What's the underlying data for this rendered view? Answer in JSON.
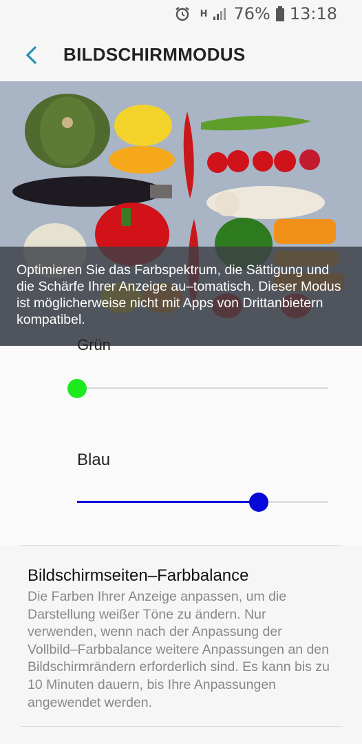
{
  "status_bar": {
    "alarm_icon": "alarm-icon",
    "network": "H",
    "signal_icon": "signal-icon",
    "battery_pct": "76%",
    "battery_icon": "battery-icon",
    "time": "13:18"
  },
  "header": {
    "back_icon": "back-arrow-icon",
    "title": "BILDSCHIRMMODUS"
  },
  "hero": {
    "description": "Optimieren Sie das Farbspektrum, die Sättigung und die Schärfe Ihrer Anzeige au–tomatisch. Dieser Modus ist möglicherweise nicht mit Apps von Drittanbietern kompatibel."
  },
  "sliders": {
    "green": {
      "label": "Grün",
      "value": 0.0,
      "color": "#1ee81e"
    },
    "blue": {
      "label": "Blau",
      "value": 0.725,
      "color": "#0808d8"
    }
  },
  "colors": {
    "accent": "#2a8fb0"
  },
  "edge_balance": {
    "title": "Bildschirmseiten–Farbbalance",
    "description": "Die Farben Ihrer Anzeige anpassen, um die Darstellung weißer Töne zu ändern. Nur verwenden, wenn nach der Anpassung der Vollbild–Farbbalance weitere Anpassungen an den Bildschirmrändern erforderlich sind. Es kann bis zu 10 Minuten dauern, bis Ihre Anpassungen angewendet werden."
  }
}
